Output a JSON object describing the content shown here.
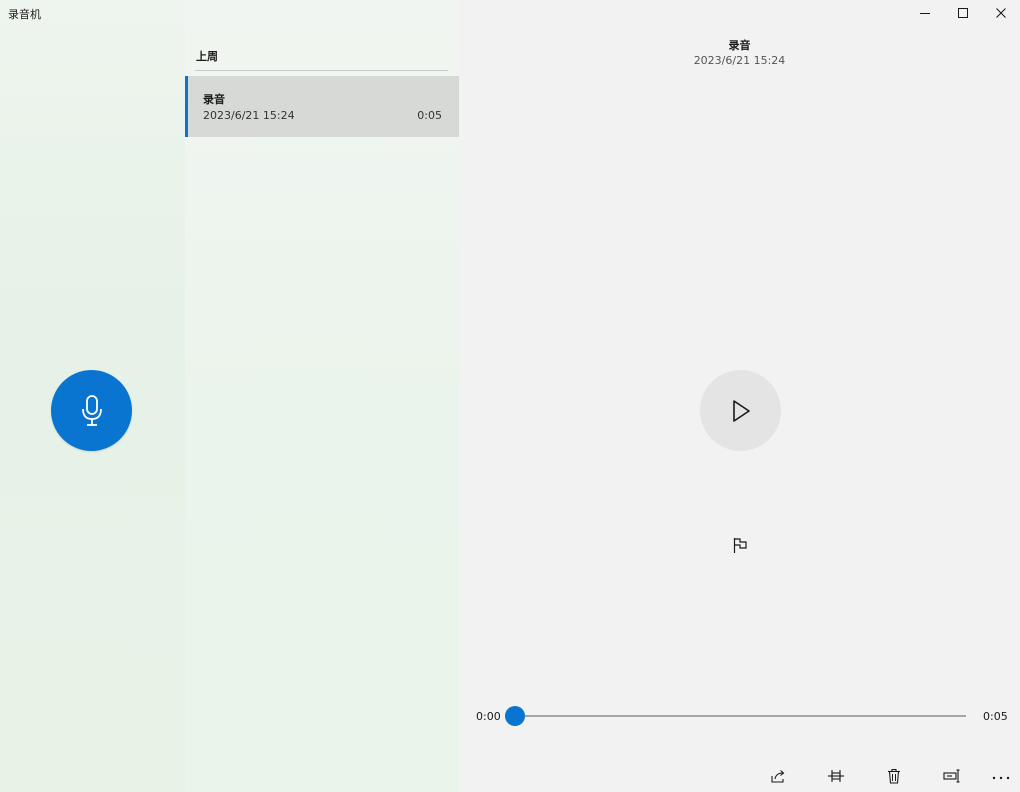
{
  "window": {
    "title": "录音机",
    "minimize_icon": "minimize-icon",
    "maximize_icon": "maximize-icon",
    "close_icon": "close-icon"
  },
  "record_pane": {
    "record_icon": "microphone-icon",
    "accent_color": "#0a74d1"
  },
  "list": {
    "group_label": "上周",
    "items": [
      {
        "name": "录音",
        "date": "2023/6/21 15:24",
        "duration": "0:05",
        "selected": true
      }
    ]
  },
  "playback": {
    "title": "录音",
    "date": "2023/6/21 15:24",
    "play_icon": "play-icon",
    "marker_icon": "flag-icon",
    "current_time": "0:00",
    "total_time": "0:05",
    "progress": 0
  },
  "toolbar": {
    "items": [
      {
        "icon": "share-icon"
      },
      {
        "icon": "trim-icon"
      },
      {
        "icon": "delete-icon"
      },
      {
        "icon": "rename-icon"
      },
      {
        "icon": "more-icon"
      }
    ]
  }
}
